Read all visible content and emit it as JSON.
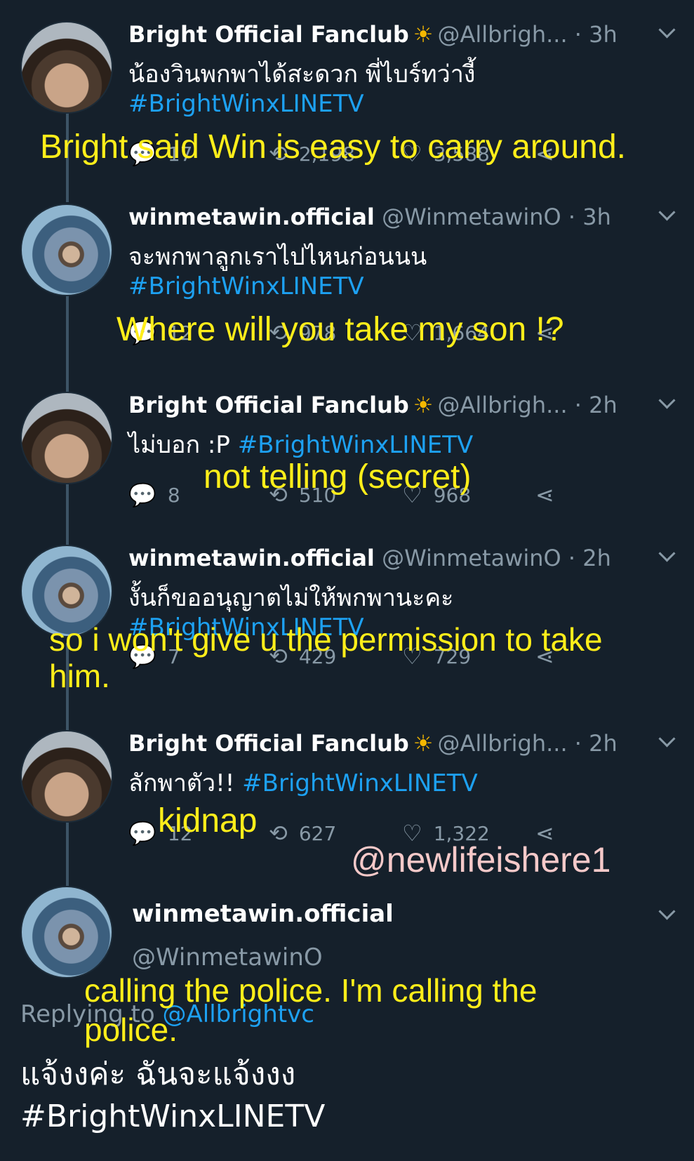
{
  "tweets": [
    {
      "name": "Bright Official Fanclub",
      "sun": "☀",
      "handle": "@Allbrigh...",
      "time": "· 3h",
      "text": "น้องวินพกพาได้สะดวก พี่ไบร์ทว่างี้",
      "hashtag": "#BrightWinxLINETV",
      "replies": "17",
      "retweets": "2,198",
      "likes": "3,588",
      "caption": "Bright said Win is easy to carry around."
    },
    {
      "name": "winmetawin.official",
      "handle": "@WinmetawinO",
      "time": "· 3h",
      "text": "จะพกพาลูกเราไปไหนก่อนนน",
      "hashtag": "#BrightWinxLINETV",
      "replies": "12",
      "retweets": "978",
      "likes": "1,664",
      "caption": "Where will you take my son !?"
    },
    {
      "name": "Bright Official Fanclub",
      "sun": "☀",
      "handle": "@Allbrigh...",
      "time": "· 2h",
      "text": "ไม่บอก :P ",
      "hashtag": "#BrightWinxLINETV",
      "replies": "8",
      "retweets": "510",
      "likes": "968",
      "caption": "not telling (secret)"
    },
    {
      "name": "winmetawin.official",
      "handle": "@WinmetawinO",
      "time": "· 2h",
      "text": "งั้นก็ขออนุญาตไม่ให้พกพานะคะ",
      "hashtag": "#BrightWinxLINETV",
      "replies": "7",
      "retweets": "429",
      "likes": "729",
      "caption_line1": "so i won't give u the permission to take",
      "caption_line2": "him."
    },
    {
      "name": "Bright Official Fanclub",
      "sun": "☀",
      "handle": "@Allbrigh...",
      "time": "· 2h",
      "text": "ลักพาตัว!! ",
      "hashtag": "#BrightWinxLINETV",
      "replies": "12",
      "retweets": "627",
      "likes": "1,322",
      "caption": "kidnap"
    },
    {
      "name": "winmetawin.official",
      "handle": "@WinmetawinO",
      "replying_prefix": "Replying to ",
      "replying_handle": "@Allbrightvc",
      "text": "แจ้งงค่ะ ฉันจะแจ้งงง",
      "hashtag": "#BrightWinxLINETV",
      "caption_line1": "calling the police. I'm calling the",
      "caption_line2": "police."
    }
  ],
  "watermark": "@newlifeishere1"
}
